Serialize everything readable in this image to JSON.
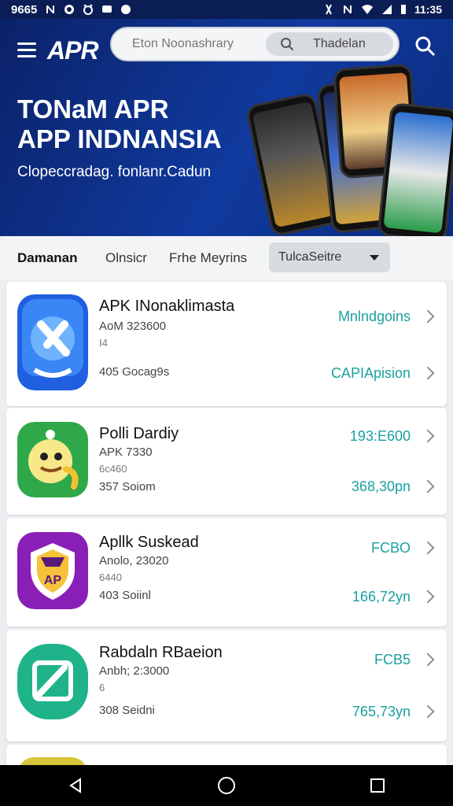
{
  "status_bar": {
    "left_text": "9665",
    "left_icons": [
      "notification-n-icon",
      "d-icon",
      "alarm-icon",
      "message-icon",
      "sync-icon"
    ],
    "right_icons": [
      "vibrate-icon",
      "no-signal-icon",
      "wifi-icon",
      "signal-icon",
      "battery-icon"
    ],
    "time": "11:35"
  },
  "header": {
    "logo": "APR",
    "search_placeholder": "Eton Noonashrary",
    "search_pill_label": "Thadelan"
  },
  "hero": {
    "title_line1": "TONaM APR",
    "title_line2": "APP INDNANSIA",
    "subtitle": "Clopeccradag. fonlanr.Cadun"
  },
  "filters": {
    "tabs": [
      {
        "label": "Damanan",
        "active": true
      },
      {
        "label": "Olnsicr",
        "active": false
      },
      {
        "label": "Frhe Meyrins",
        "active": false
      }
    ],
    "select_label": "TulcaSeitre"
  },
  "apps": [
    {
      "name": "APK INonaklimasta",
      "meta1": "AoM 323600",
      "meta2": "I4",
      "meta3": "405 Gocag9s",
      "right1": "Mnlndgoins",
      "right2": "CAPIApision",
      "icon": "blue-k-app-icon"
    },
    {
      "name": "Polli Dardiy",
      "meta1": "APK 7330",
      "meta2": "6c460",
      "meta3": "357 Soiom",
      "right1": "193:E600",
      "right2": "368,30pn",
      "icon": "green-bird-app-icon"
    },
    {
      "name": "Apllk Suskead",
      "meta1": "Anolo, 23020",
      "meta2": "6440",
      "meta3": "403 Soiinl",
      "right1": "FCBO",
      "right2": "166,72yn",
      "icon": "purple-shield-app-icon"
    },
    {
      "name": "Rabdaln RBaeion",
      "meta1": "Anbh; 2:3000",
      "meta2": "6",
      "meta3": "308 Seidni",
      "right1": "FCB5",
      "right2": "765,73yn",
      "icon": "green-square-app-icon"
    }
  ],
  "colors": {
    "hero_bg": "#0b2269",
    "accent_teal": "#1aa0a0",
    "nav_bg": "#000000"
  },
  "nav": {
    "buttons": [
      "back-icon",
      "home-icon",
      "recents-icon"
    ]
  }
}
